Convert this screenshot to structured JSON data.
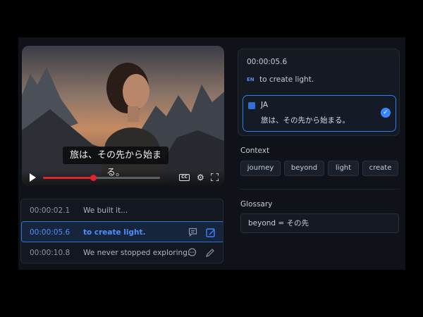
{
  "video": {
    "subtitle": "旅は、その先から始まる。",
    "progress": 0.43,
    "cc_label": "CC",
    "gear_glyph": "⚙"
  },
  "transcript": {
    "rows": [
      {
        "timecode": "00:00:02.1",
        "text": "We built it...",
        "active": false
      },
      {
        "timecode": "00:00:05.6",
        "text": "to create light.",
        "active": true
      },
      {
        "timecode": "00:00:10.8",
        "text": "We never stopped exploring.",
        "active": false
      }
    ]
  },
  "segment": {
    "timecode": "00:00:05.6",
    "source_lang": "EN",
    "source_text": "to create light.",
    "target_lang": "JA",
    "target_text": "旅は、その先から始まる。",
    "check_glyph": "✓"
  },
  "context": {
    "title": "Context",
    "chips": [
      "journey",
      "beyond",
      "light",
      "create"
    ]
  },
  "glossary": {
    "title": "Glossary",
    "entry": "beyond  =  その先"
  },
  "colors": {
    "accent": "#3a86ff",
    "progress": "#e0242b",
    "background": "#0f1319"
  }
}
